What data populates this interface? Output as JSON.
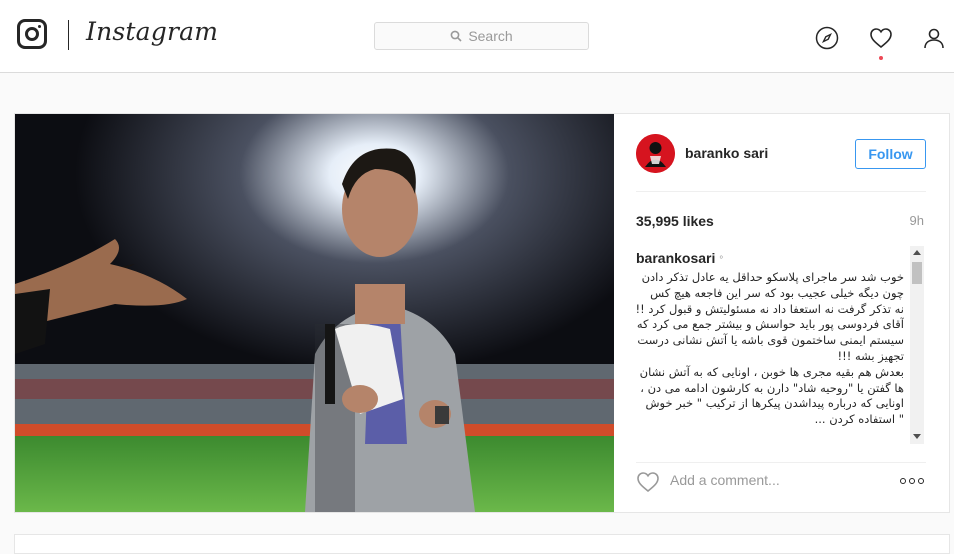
{
  "header": {
    "wordmark": "Instagram",
    "search_placeholder": "Search",
    "icons": [
      "instagram-glyph-icon",
      "explore-compass-icon",
      "activity-heart-icon",
      "profile-person-icon"
    ]
  },
  "post": {
    "author": {
      "username": "baranko sari",
      "avatar_icon": "red-flag-avatar"
    },
    "follow_label": "Follow",
    "likes": "35,995 likes",
    "time": "9h",
    "caption_user": "barankosari",
    "caption_lines": [
      "خوب شد سر ماجرای پلاسکو حداقل یه عادل تذکر دادن",
      "چون دیگه خیلی عجیب بود که سر این فاجعه هیچ کس",
      "نه تذکر گرفت نه استعفا داد نه مسئولیتش و قبول کرد !!!",
      "آقای فردوسی پور باید حواسش و بیشتر جمع می کرد که",
      "سیستم ایمنی ساختمون قوی باشه یا آتش نشانی درست",
      "تجهیز بشه !!!",
      "بعدش هم بقیه مجری ها خوبن ، اونایی که به آتش نشان",
      "ها گفتن یا \"روحیه شاد\" دارن به کارشون ادامه می دن ،",
      "اونایی که درباره پیداشدن پیکرها از ترکیب \" خبر خوش",
      "\" استفاده کردن ..."
    ],
    "comment_placeholder": "Add a comment...",
    "comment_icons": [
      "like-heart-icon",
      "more-options-icon"
    ]
  },
  "colors": {
    "accent": "#3897f0",
    "notification": "#ed4956",
    "text": "#262626",
    "muted": "#999999",
    "border": "#dbdbdb"
  }
}
